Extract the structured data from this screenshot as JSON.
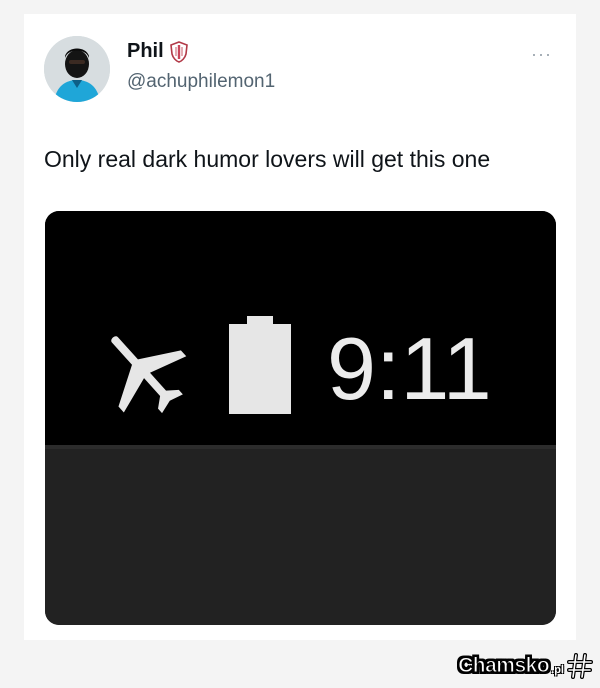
{
  "tweet": {
    "author": {
      "display_name": "Phil",
      "handle": "@achuphilemon1",
      "badge_icon": "shield-badge-icon",
      "avatar_icon": "profile-avatar"
    },
    "more_label": "···",
    "text": "Only real dark humor lovers will get this one",
    "media": {
      "clock_text": "9:11",
      "airplane_icon": "airplane-mode-icon",
      "battery_icon": "battery-icon",
      "colors": {
        "statusbar_bg": "#000000",
        "lower_bg": "#222222",
        "icon_fg": "#e6e6e6"
      }
    }
  },
  "watermark": {
    "text": "Chamsko",
    "suffix": ".pl"
  }
}
